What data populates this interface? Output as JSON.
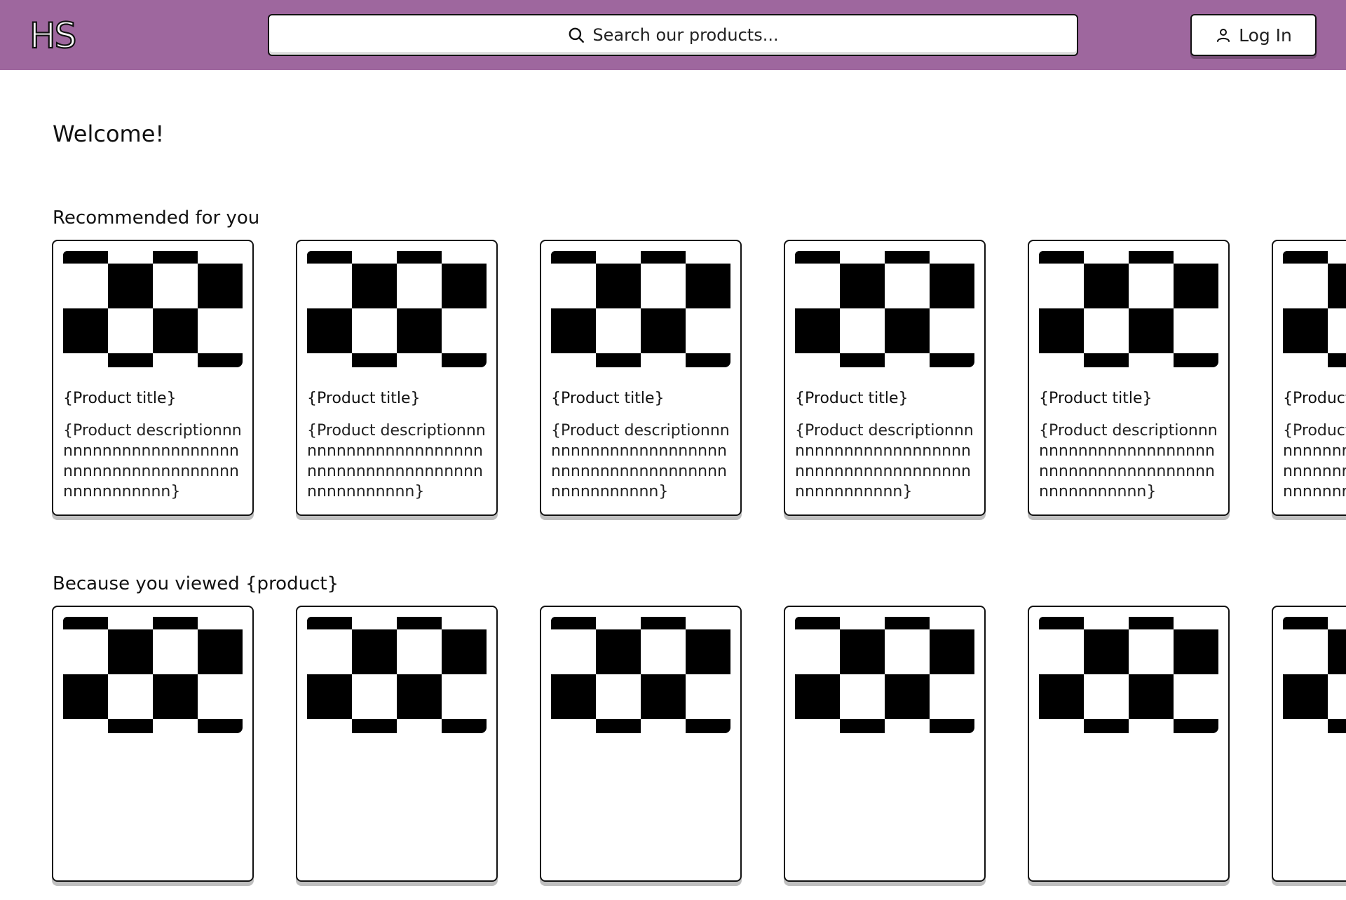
{
  "header": {
    "logo": "HS",
    "search_placeholder": "Search our products...",
    "login_label": "Log In",
    "background_color": "#9e679e",
    "search_icon": "search-icon",
    "login_icon": "user-icon"
  },
  "main": {
    "welcome": "Welcome!",
    "sections": [
      {
        "title": "Recommended for you",
        "cards": [
          {
            "title": "{Product title}",
            "description": "{Product descriptionnnnnnnnnnnnnnnnnnnnnnnnnnnnnnnnnnnnnnnnnnnnnnnnnn}"
          },
          {
            "title": "{Product title}",
            "description": "{Product descriptionnnnnnnnnnnnnnnnnnnnnnnnnnnnnnnnnnnnnnnnnnnnnnnnnn}"
          },
          {
            "title": "{Product title}",
            "description": "{Product descriptionnnnnnnnnnnnnnnnnnnnnnnnnnnnnnnnnnnnnnnnnnnnnnnnnn}"
          },
          {
            "title": "{Product title}",
            "description": "{Product descriptionnnnnnnnnnnnnnnnnnnnnnnnnnnnnnnnnnnnnnnnnnnnnnnnnn}"
          },
          {
            "title": "{Product title}",
            "description": "{Product descriptionnnnnnnnnnnnnnnnnnnnnnnnnnnnnnnnnnnnnnnnnnnnnnnnnn}"
          },
          {
            "title": "{Product title}",
            "description": "{Product descriptionnnnnnnnnnnnnnnnnnnnnnnnnnnnnnnnnnnnnnnnnnnnnnnnnn}"
          }
        ]
      },
      {
        "title": "Because you viewed {product}",
        "cards": [
          {
            "title": "",
            "description": ""
          },
          {
            "title": "",
            "description": ""
          },
          {
            "title": "",
            "description": ""
          },
          {
            "title": "",
            "description": ""
          },
          {
            "title": "",
            "description": ""
          },
          {
            "title": "",
            "description": ""
          }
        ]
      }
    ]
  }
}
